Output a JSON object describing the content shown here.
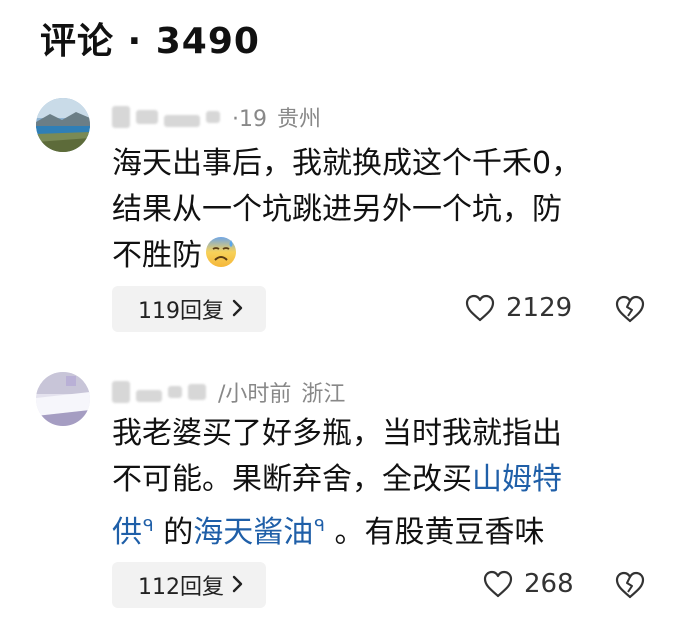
{
  "header": {
    "title": "评论 · 3490"
  },
  "comments": [
    {
      "meta_time": "·19",
      "meta_region": "贵州",
      "text_lines": [
        "海天出事后，我就换成这个千禾0，",
        "结果从一个坑跳进另外一个坑，防",
        "不胜防"
      ],
      "emoji": "anxious-sweat-face",
      "reply_label": "119回复",
      "like_count": "2129"
    },
    {
      "meta_time": "/小时前",
      "meta_region": "浙江",
      "text_line1": "我老婆买了好多瓶，当时我就指出",
      "text_line2_a": "不可能。果断弃舍，全改买",
      "link1": "山姆特",
      "link1_cont": "供",
      "text_de": " 的",
      "link2": "海天酱油",
      "text_tail": " 。有股黄豆香味",
      "search_mark": "ᑫ",
      "reply_label": "112回复",
      "like_count": "268"
    }
  ],
  "icons": {
    "heart": "heart-outline-icon",
    "broken_heart": "broken-heart-icon",
    "chevron": "chevron-right-icon"
  },
  "colors": {
    "link": "#1f5fa8",
    "meta": "#888888",
    "pill_bg": "#f2f2f2"
  }
}
